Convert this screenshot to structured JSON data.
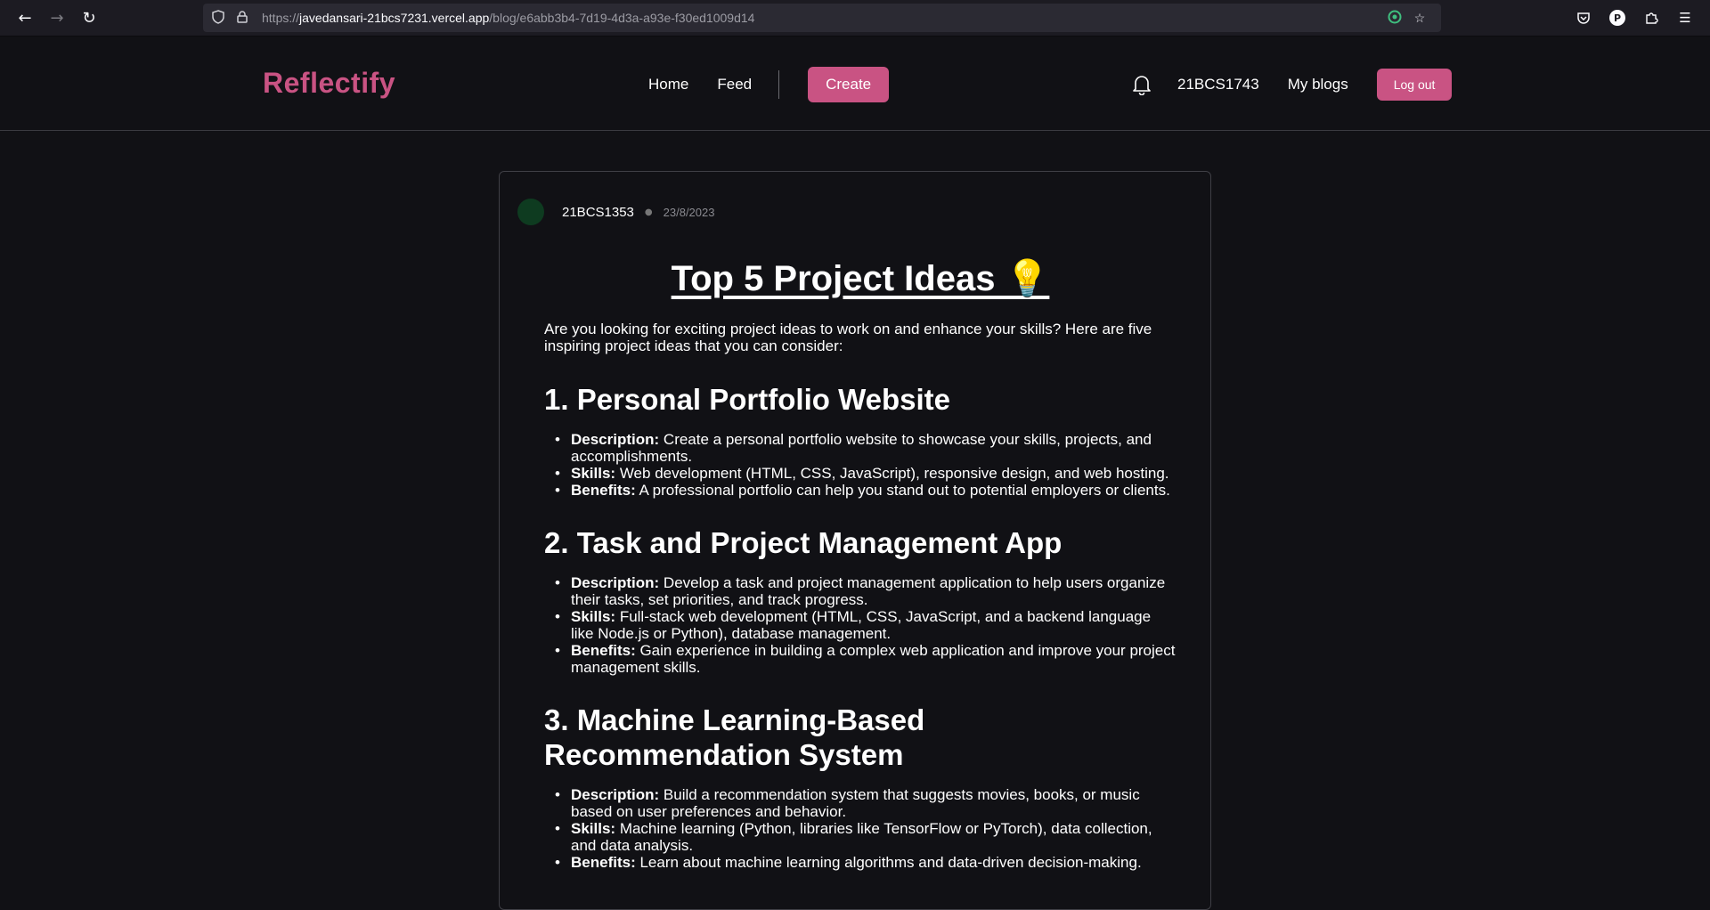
{
  "browser": {
    "url_protocol": "https://",
    "url_host": "javedansari-21bcs7231.vercel.app",
    "url_path": "/blog/e6abb3b4-7d19-4d3a-a93e-f30ed1009d14"
  },
  "header": {
    "brand": "Reflectify",
    "nav": {
      "home": "Home",
      "feed": "Feed",
      "create": "Create"
    },
    "user": {
      "username": "21BCS1743",
      "my_blogs": "My blogs",
      "logout": "Log out"
    }
  },
  "post": {
    "author": "21BCS1353",
    "date": "23/8/2023",
    "title": "Top 5 Project Ideas 💡",
    "intro": "Are you looking for exciting project ideas to work on and enhance your skills? Here are five inspiring project ideas that you can consider:",
    "sections": [
      {
        "heading": "1. Personal Portfolio Website",
        "items": [
          {
            "label": "Description:",
            "text": " Create a personal portfolio website to showcase your skills, projects, and accomplishments."
          },
          {
            "label": "Skills:",
            "text": " Web development (HTML, CSS, JavaScript), responsive design, and web hosting."
          },
          {
            "label": "Benefits:",
            "text": " A professional portfolio can help you stand out to potential employers or clients."
          }
        ]
      },
      {
        "heading": "2. Task and Project Management App",
        "items": [
          {
            "label": "Description:",
            "text": " Develop a task and project management application to help users organize their tasks, set priorities, and track progress."
          },
          {
            "label": "Skills:",
            "text": " Full-stack web development (HTML, CSS, JavaScript, and a backend language like Node.js or Python), database management."
          },
          {
            "label": "Benefits:",
            "text": " Gain experience in building a complex web application and improve your project management skills."
          }
        ]
      },
      {
        "heading": "3. Machine Learning-Based Recommendation System",
        "items": [
          {
            "label": "Description:",
            "text": " Build a recommendation system that suggests movies, books, or music based on user preferences and behavior."
          },
          {
            "label": "Skills:",
            "text": " Machine learning (Python, libraries like TensorFlow or PyTorch), data collection, and data analysis."
          },
          {
            "label": "Benefits:",
            "text": " Learn about machine learning algorithms and data-driven decision-making."
          }
        ]
      }
    ]
  },
  "colors": {
    "accent": "#c95383",
    "background": "#111115"
  }
}
